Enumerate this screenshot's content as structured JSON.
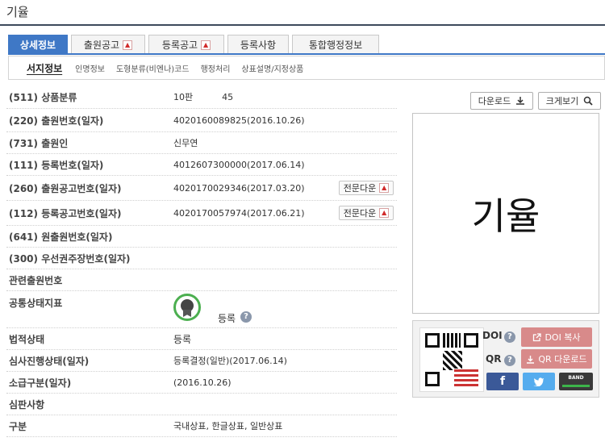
{
  "page": {
    "title": "기율"
  },
  "tabs": [
    {
      "label": "상세정보",
      "active": true,
      "pdf": false
    },
    {
      "label": "출원공고",
      "active": false,
      "pdf": true
    },
    {
      "label": "등록공고",
      "active": false,
      "pdf": true
    },
    {
      "label": "등록사항",
      "active": false,
      "pdf": false
    },
    {
      "label": "통합행정정보",
      "active": false,
      "pdf": false
    }
  ],
  "subtabs": [
    "서지정보",
    "인명정보",
    "도형분류(비엔나)코드",
    "행정처리",
    "상표설명/지정상품"
  ],
  "icons": {
    "pdf": "pdf-icon",
    "download": "download-icon",
    "zoom": "magnifier-icon",
    "help": "help-icon",
    "medal": "medal-icon",
    "external": "external-link-icon"
  },
  "details": {
    "classification": {
      "label": "(511) 상품분류",
      "edition": "10판",
      "class": "45"
    },
    "application": {
      "label": "(220) 출원번호(일자)",
      "value": "4020160089825(2016.10.26)"
    },
    "applicant": {
      "label": "(731) 출원인",
      "value": "신무연"
    },
    "registration": {
      "label": "(111) 등록번호(일자)",
      "value": "4012607300000(2017.06.14)"
    },
    "app_publication": {
      "label": "(260) 출원공고번호(일자)",
      "value": "4020170029346(2017.03.20)",
      "button": "전문다운"
    },
    "reg_publication": {
      "label": "(112) 등록공고번호(일자)",
      "value": "4020170057974(2017.06.21)",
      "button": "전문다운"
    },
    "original_app": {
      "label": "(641) 원출원번호(일자)",
      "value": ""
    },
    "priority": {
      "label": "(300) 우선권주장번호(일자)",
      "value": ""
    },
    "related": {
      "label": "관련출원번호",
      "value": ""
    },
    "status_indicator": {
      "label": "공통상태지표",
      "value": "등록"
    },
    "legal_status": {
      "label": "법적상태",
      "value": "등록"
    },
    "exam_status": {
      "label": "심사진행상태(일자)",
      "value": "등록결정(일반)(2017.06.14)"
    },
    "retro": {
      "label": "소급구분(일자)",
      "value": "(2016.10.26)"
    },
    "trial": {
      "label": "심판사항",
      "value": ""
    },
    "category": {
      "label": "구분",
      "value": "국내상표, 한글상표, 일반상표"
    }
  },
  "preview": {
    "download_label": "다운로드",
    "zoom_label": "크게보기",
    "mark_text": "기율"
  },
  "share": {
    "doi_label": "DOI",
    "qr_label": "QR",
    "doi_copy_label": "DOI 복사",
    "qr_download_label": "QR 다운로드",
    "facebook": "f",
    "band": "BAND",
    "colors": {
      "facebook": "#3b5998",
      "twitter": "#55acee",
      "band": "#3a3a3a",
      "action": "#d88a8a",
      "tab_active": "#3f78c6"
    }
  }
}
